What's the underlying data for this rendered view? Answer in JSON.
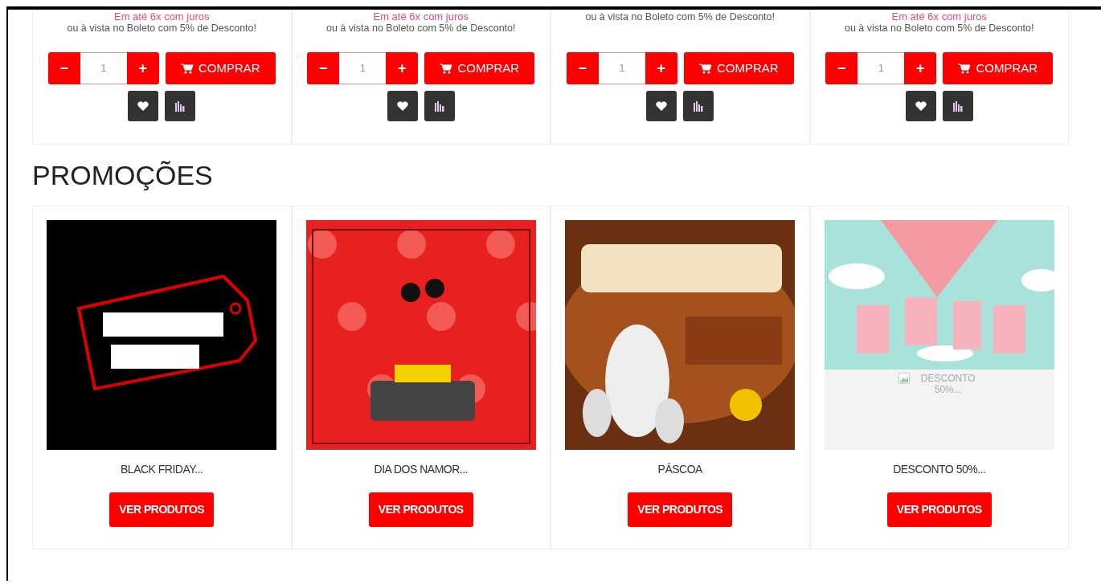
{
  "products": [
    {
      "installment": "Em até 6x com juros",
      "cash_note": "ou à vista no Boleto com 5% de Desconto!",
      "quantity": "1",
      "minus": "−",
      "plus": "+",
      "buy_label": "COMPRAR"
    },
    {
      "installment": "Em até 6x com juros",
      "cash_note": "ou à vista no Boleto com 5% de Desconto!",
      "quantity": "1",
      "minus": "−",
      "plus": "+",
      "buy_label": "COMPRAR"
    },
    {
      "cash_note": "ou à vista no Boleto com 5% de Desconto!",
      "quantity": "1",
      "minus": "−",
      "plus": "+",
      "buy_label": "COMPRAR"
    },
    {
      "installment": "Em até 6x com juros",
      "cash_note": "ou à vista no Boleto com 5% de Desconto!",
      "quantity": "1",
      "minus": "−",
      "plus": "+",
      "buy_label": "COMPRAR"
    }
  ],
  "promotions_heading": "PROMOÇÕES",
  "promotions": [
    {
      "kind": "tag",
      "title": "BLACK FRIDAY...",
      "button": "VER PRODUTOS"
    },
    {
      "kind": "hearts",
      "title": "DIA DOS NAMOR...",
      "button": "VER PRODUTOS"
    },
    {
      "kind": "brown",
      "title": "PÁSCOA",
      "button": "VER PRODUTOS"
    },
    {
      "kind": "broken",
      "alt_text": "DESCONTO 50%...",
      "title": "DESCONTO 50%...",
      "button": "VER PRODUTOS"
    }
  ]
}
